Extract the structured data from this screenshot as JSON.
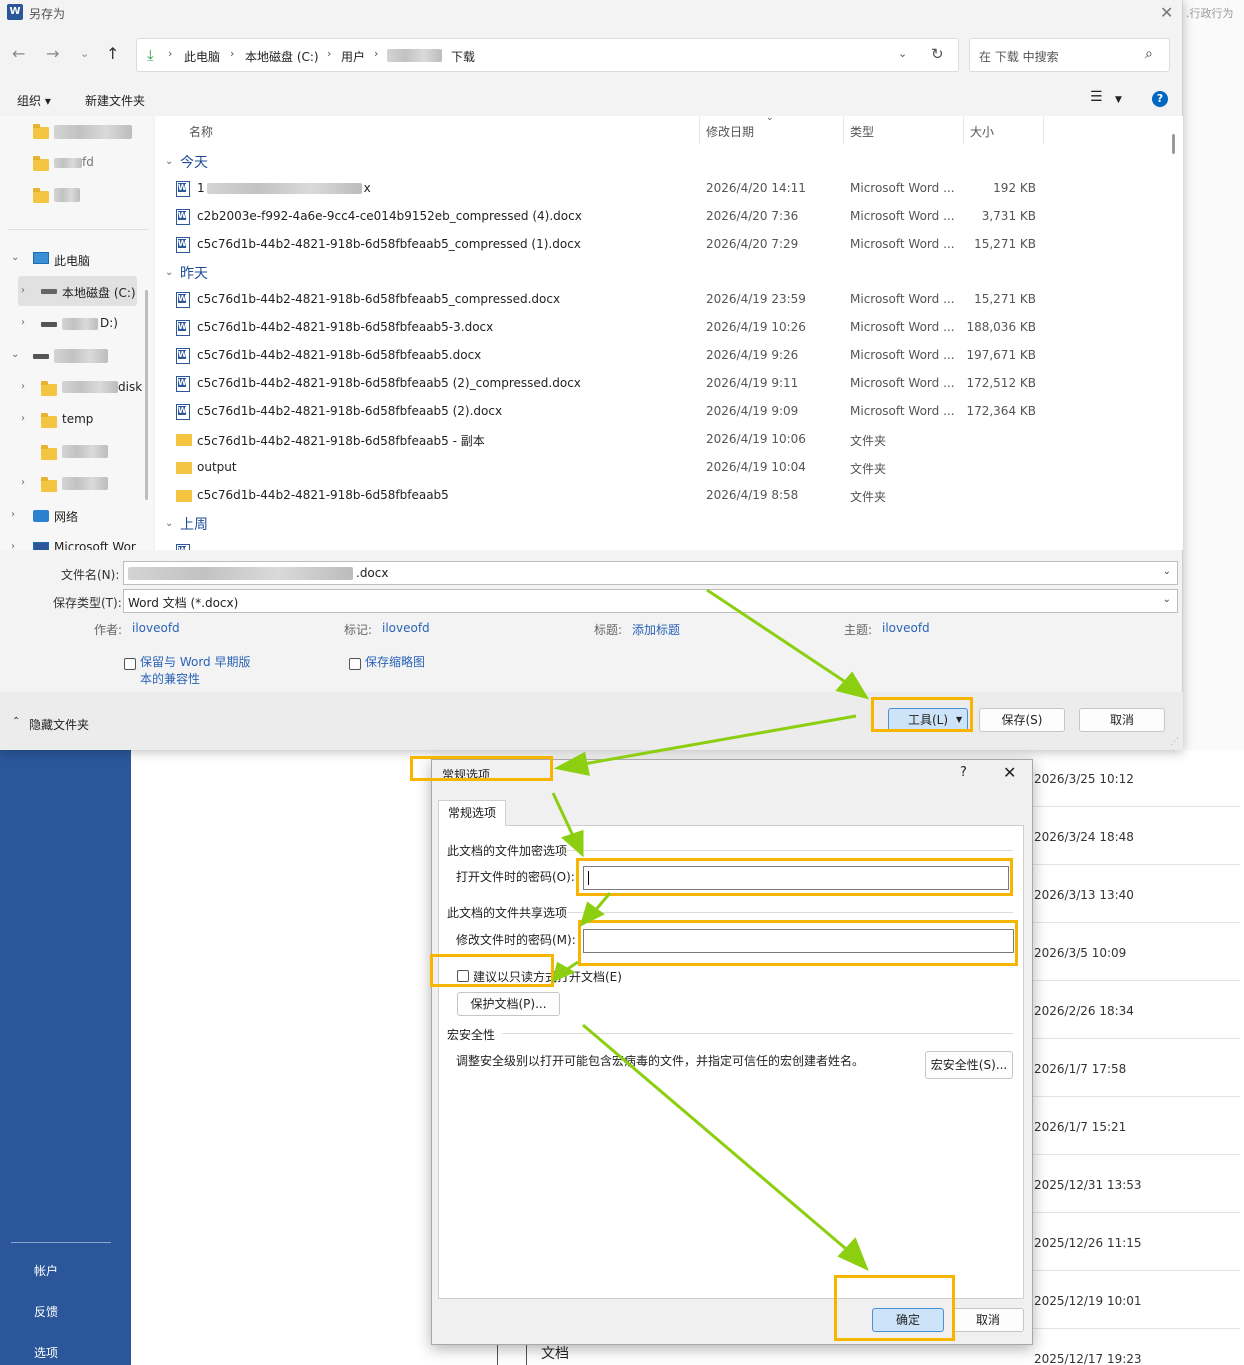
{
  "background": {
    "top_right_text": ".行政行为",
    "dates": [
      "2026/3/25 10:12",
      "2026/3/24 18:48",
      "2026/3/13 13:40",
      "2026/3/5 10:09",
      "2026/2/26 18:34",
      "2026/1/7 17:58",
      "2026/1/7 15:21",
      "2025/12/31 13:53",
      "2025/12/26 11:15",
      "2025/12/19 10:01",
      "2025/12/17 19:23"
    ],
    "doc_label": "文档",
    "sidebar": {
      "account": "帐户",
      "feedback": "反馈",
      "options": "选项"
    },
    "sidebar_color": "#2b579a"
  },
  "saveas": {
    "title": "另存为",
    "app_icon": "W",
    "breadcrumb": [
      "此电脑",
      "本地磁盘 (C:)",
      "用户",
      "下载"
    ],
    "search_placeholder": "在 下载 中搜索",
    "toolbar": {
      "organize": "组织 ▾",
      "new_folder": "新建文件夹"
    },
    "nav": {
      "this_pc": "此电脑",
      "local_disk": "本地磁盘 (C:)",
      "drive_d": "D:)",
      "disk": "disk",
      "temp": "temp",
      "network": "网络",
      "microsoft_word": "Microsoft Wor",
      "folder_fragment": "fd"
    },
    "columns": {
      "name": "名称",
      "date": "修改日期",
      "type": "类型",
      "size": "大小"
    },
    "groups": {
      "today": "今天",
      "yesterday": "昨天",
      "last_week": "上周"
    },
    "files_today": [
      {
        "name_prefix": "1",
        "name_suffix": "x",
        "date": "2026/4/20 14:11",
        "type": "Microsoft Word ...",
        "size": "192 KB"
      },
      {
        "name": "c2b2003e-f992-4a6e-9cc4-ce014b9152eb_compressed (4).docx",
        "date": "2026/4/20 7:36",
        "type": "Microsoft Word ...",
        "size": "3,731 KB"
      },
      {
        "name": "c5c76d1b-44b2-4821-918b-6d58fbfeaab5_compressed (1).docx",
        "date": "2026/4/20 7:29",
        "type": "Microsoft Word ...",
        "size": "15,271 KB"
      }
    ],
    "files_yesterday": [
      {
        "name": "c5c76d1b-44b2-4821-918b-6d58fbfeaab5_compressed.docx",
        "date": "2026/4/19 23:59",
        "type": "Microsoft Word ...",
        "size": "15,271 KB",
        "kind": "doc"
      },
      {
        "name": "c5c76d1b-44b2-4821-918b-6d58fbfeaab5-3.docx",
        "date": "2026/4/19 10:26",
        "type": "Microsoft Word ...",
        "size": "188,036 KB",
        "kind": "doc"
      },
      {
        "name": "c5c76d1b-44b2-4821-918b-6d58fbfeaab5.docx",
        "date": "2026/4/19 9:26",
        "type": "Microsoft Word ...",
        "size": "197,671 KB",
        "kind": "doc"
      },
      {
        "name": "c5c76d1b-44b2-4821-918b-6d58fbfeaab5 (2)_compressed.docx",
        "date": "2026/4/19 9:11",
        "type": "Microsoft Word ...",
        "size": "172,512 KB",
        "kind": "doc"
      },
      {
        "name": "c5c76d1b-44b2-4821-918b-6d58fbfeaab5 (2).docx",
        "date": "2026/4/19 9:09",
        "type": "Microsoft Word ...",
        "size": "172,364 KB",
        "kind": "doc"
      },
      {
        "name": "c5c76d1b-44b2-4821-918b-6d58fbfeaab5 - 副本",
        "date": "2026/4/19 10:06",
        "type": "文件夹",
        "size": "",
        "kind": "folder"
      },
      {
        "name": "output",
        "date": "2026/4/19 10:04",
        "type": "文件夹",
        "size": "",
        "kind": "folder"
      },
      {
        "name": "c5c76d1b-44b2-4821-918b-6d58fbfeaab5",
        "date": "2026/4/19 8:58",
        "type": "文件夹",
        "size": "",
        "kind": "folder"
      }
    ],
    "filename_label": "文件名(N):",
    "filename_suffix": ".docx",
    "filetype_label": "保存类型(T):",
    "filetype_value": "Word 文档 (*.docx)",
    "meta": {
      "author_label": "作者:",
      "author": "iloveofd",
      "tags_label": "标记:",
      "tags": "iloveofd",
      "title_label": "标题:",
      "title": "添加标题",
      "subject_label": "主题:",
      "subject": "iloveofd"
    },
    "compat_checkbox": {
      "line1": "保留与 Word 早期版",
      "line2": "本的兼容性"
    },
    "thumbnail_checkbox": "保存缩略图",
    "hide_folders": "隐藏文件夹",
    "tools_button": "工具(L)",
    "save_button": "保存(S)",
    "cancel_button": "取消"
  },
  "general_options": {
    "title": "常规选项",
    "help": "?",
    "close": "✕",
    "tab": "常规选项",
    "encrypt_section": "此文档的文件加密选项",
    "open_password_label": "打开文件时的密码(O):",
    "open_password_value": "",
    "share_section": "此文档的文件共享选项",
    "modify_password_label": "修改文件时的密码(M):",
    "modify_password_value": "",
    "readonly_checkbox": "建议以只读方式打开文档(E)",
    "readonly_checked": false,
    "protect_button": "保护文档(P)...",
    "macro_section": "宏安全性",
    "macro_desc": "调整安全级别以打开可能包含宏病毒的文件，并指定可信任的宏创建者姓名。",
    "macro_button": "宏安全性(S)...",
    "ok_button": "确定",
    "cancel_button": "取消"
  },
  "annotation": {
    "highlight_color": "#f7b500",
    "arrow_color": "#8ccf10"
  }
}
